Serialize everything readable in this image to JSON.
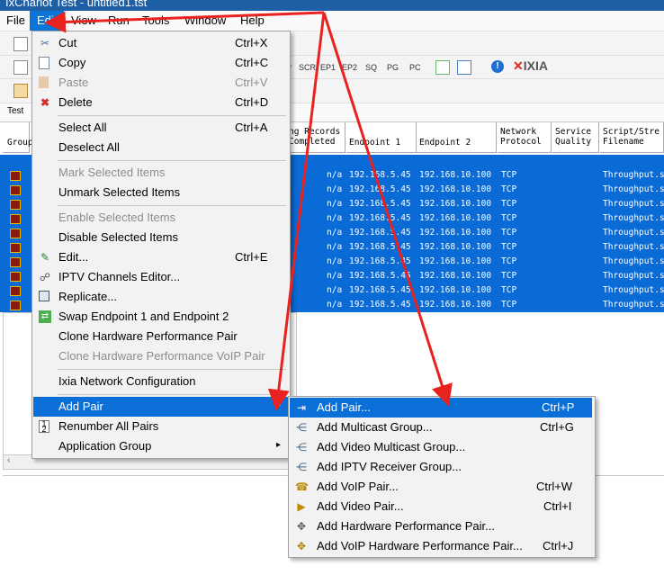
{
  "window": {
    "title": "IxChariot Test - untitled1.tst"
  },
  "menubar": {
    "file": "File",
    "edit": "Edit",
    "view": "View",
    "run": "Run",
    "tools": "Tools",
    "window": "Window",
    "help": "Help"
  },
  "toolbar": {
    "labels": [
      "P",
      "SCR",
      "EP1",
      "EP2",
      "SQ",
      "PG",
      "PC"
    ],
    "brand": "IXIA",
    "tab": "Test"
  },
  "table": {
    "headers": {
      "group": "Group",
      "records": "ng Records\nCompleted",
      "ep1": "Endpoint 1",
      "ep2": "Endpoint 2",
      "protocol": "Network\nProtocol",
      "qos": "Service\nQuality",
      "script": "Script/Stre\nFilename"
    },
    "rows": [
      {
        "records": "n/a",
        "ep1": "192.168.5.45",
        "ep2": "192.168.10.100",
        "protocol": "TCP",
        "script": "Throughput.s"
      },
      {
        "records": "n/a",
        "ep1": "192.168.5.45",
        "ep2": "192.168.10.100",
        "protocol": "TCP",
        "script": "Throughput.s"
      },
      {
        "records": "n/a",
        "ep1": "192.168.5.45",
        "ep2": "192.168.10.100",
        "protocol": "TCP",
        "script": "Throughput.s"
      },
      {
        "records": "n/a",
        "ep1": "192.168.5.45",
        "ep2": "192.168.10.100",
        "protocol": "TCP",
        "script": "Throughput.s"
      },
      {
        "records": "n/a",
        "ep1": "192.168.5.45",
        "ep2": "192.168.10.100",
        "protocol": "TCP",
        "script": "Throughput.s"
      },
      {
        "records": "n/a",
        "ep1": "192.168.5.45",
        "ep2": "192.168.10.100",
        "protocol": "TCP",
        "script": "Throughput.s"
      },
      {
        "records": "n/a",
        "ep1": "192.168.5.45",
        "ep2": "192.168.10.100",
        "protocol": "TCP",
        "script": "Throughput.s"
      },
      {
        "records": "n/a",
        "ep1": "192.168.5.45",
        "ep2": "192.168.10.100",
        "protocol": "TCP",
        "script": "Throughput.s"
      },
      {
        "records": "n/a",
        "ep1": "192.168.5.45",
        "ep2": "192.168.10.100",
        "protocol": "TCP",
        "script": "Throughput.s"
      },
      {
        "records": "n/a",
        "ep1": "192.168.5.45",
        "ep2": "192.168.10.100",
        "protocol": "TCP",
        "script": "Throughput.s"
      }
    ]
  },
  "edit_menu": {
    "cut": "Cut",
    "cut_sc": "Ctrl+X",
    "copy": "Copy",
    "copy_sc": "Ctrl+C",
    "paste": "Paste",
    "paste_sc": "Ctrl+V",
    "delete": "Delete",
    "delete_sc": "Ctrl+D",
    "select_all": "Select All",
    "select_all_sc": "Ctrl+A",
    "deselect_all": "Deselect All",
    "mark_selected": "Mark Selected Items",
    "unmark_selected": "Unmark Selected Items",
    "enable_selected": "Enable Selected Items",
    "disable_selected": "Disable Selected Items",
    "edit": "Edit...",
    "edit_sc": "Ctrl+E",
    "iptv_editor": "IPTV Channels Editor...",
    "replicate": "Replicate...",
    "swap_endpoints": "Swap Endpoint 1 and Endpoint 2",
    "clone_hw_pair": "Clone Hardware Performance Pair",
    "clone_hw_voip_pair": "Clone Hardware Performance VoIP Pair",
    "ixia_network_config": "Ixia Network Configuration",
    "add_pair": "Add Pair",
    "renumber_pairs": "Renumber All Pairs",
    "application_group": "Application Group"
  },
  "add_pair_menu": {
    "add_pair": "Add Pair...",
    "add_pair_sc": "Ctrl+P",
    "add_multicast": "Add Multicast Group...",
    "add_multicast_sc": "Ctrl+G",
    "add_video_multicast": "Add Video Multicast Group...",
    "add_iptv_receiver": "Add IPTV Receiver Group...",
    "add_voip": "Add VoIP Pair...",
    "add_voip_sc": "Ctrl+W",
    "add_video": "Add Video Pair...",
    "add_video_sc": "Ctrl+I",
    "add_hw_perf": "Add Hardware Performance Pair...",
    "add_voip_hw_perf": "Add VoIP Hardware Performance Pair...",
    "add_voip_hw_perf_sc": "Ctrl+J"
  },
  "colors": {
    "selection": "#0a6ad6",
    "annotation_arrow": "#e8231f"
  }
}
